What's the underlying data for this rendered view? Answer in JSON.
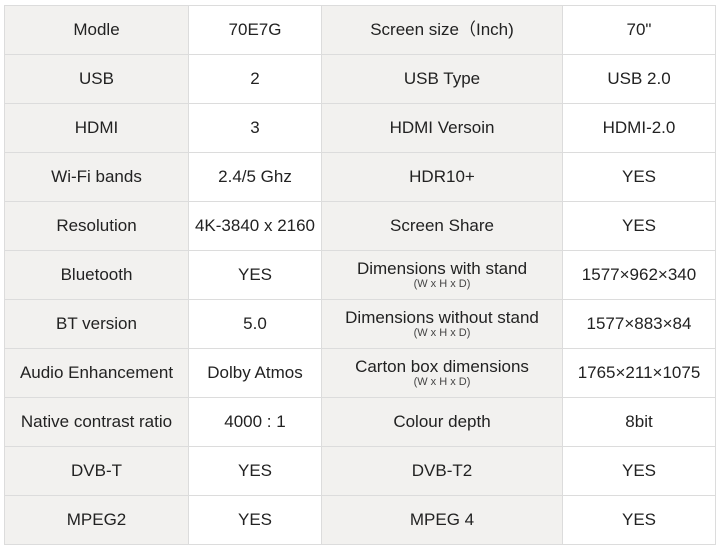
{
  "rows": [
    {
      "label_left": "Modle",
      "value_left": "70E7G",
      "label_right": "Screen size（Inch)",
      "sub_right": "",
      "value_right": "70\""
    },
    {
      "label_left": "USB",
      "value_left": "2",
      "label_right": "USB Type",
      "sub_right": "",
      "value_right": "USB 2.0"
    },
    {
      "label_left": "HDMI",
      "value_left": "3",
      "label_right": "HDMI Versoin",
      "sub_right": "",
      "value_right": "HDMI-2.0"
    },
    {
      "label_left": "Wi-Fi bands",
      "value_left": "2.4/5 Ghz",
      "label_right": "HDR10+",
      "sub_right": "",
      "value_right": "YES"
    },
    {
      "label_left": "Resolution",
      "value_left": "4K-3840 x 2160",
      "label_right": "Screen Share",
      "sub_right": "",
      "value_right": "YES"
    },
    {
      "label_left": "Bluetooth",
      "value_left": "YES",
      "label_right": "Dimensions with stand",
      "sub_right": "(W x H x D)",
      "value_right": "1577×962×340"
    },
    {
      "label_left": "BT version",
      "value_left": "5.0",
      "label_right": "Dimensions without stand",
      "sub_right": "(W x H x D)",
      "value_right": "1577×883×84"
    },
    {
      "label_left": "Audio Enhancement",
      "value_left": "Dolby Atmos",
      "label_right": "Carton box dimensions",
      "sub_right": "(W x H x D)",
      "value_right": "1765×211×1075"
    },
    {
      "label_left": "Native contrast ratio",
      "value_left": "4000 : 1",
      "label_right": "Colour depth",
      "sub_right": "",
      "value_right": "8bit"
    },
    {
      "label_left": "DVB-T",
      "value_left": "YES",
      "label_right": "DVB-T2",
      "sub_right": "",
      "value_right": "YES"
    },
    {
      "label_left": "MPEG2",
      "value_left": "YES",
      "label_right": "MPEG 4",
      "sub_right": "",
      "value_right": "YES"
    }
  ]
}
